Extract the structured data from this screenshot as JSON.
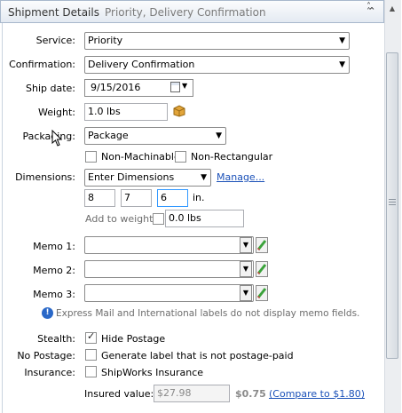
{
  "header": {
    "title": "Shipment Details",
    "subtitle": "Priority, Delivery Confirmation",
    "collapse_icon": "double-chevron-up"
  },
  "form": {
    "service": {
      "label": "Service:",
      "value": "Priority"
    },
    "confirmation": {
      "label": "Confirmation:",
      "value": "Delivery Confirmation"
    },
    "ship_date": {
      "label": "Ship date:",
      "value": "9/15/2016"
    },
    "weight": {
      "label": "Weight:",
      "value": "1.0 lbs"
    },
    "packaging": {
      "label": "Packaging:",
      "value": "Package"
    },
    "non_machinable": {
      "label": "Non-Machinable",
      "checked": false
    },
    "non_rectangular": {
      "label": "Non-Rectangular",
      "checked": false
    },
    "dimensions": {
      "label": "Dimensions:",
      "value": "Enter Dimensions",
      "manage_link": "Manage...",
      "length": "8",
      "width": "7",
      "height": "6",
      "unit": "in.",
      "add_to_weight_label": "Add to weight",
      "add_to_weight_checked": false,
      "add_weight_value": "0.0 lbs"
    },
    "memos": [
      {
        "label": "Memo 1:",
        "value": ""
      },
      {
        "label": "Memo 2:",
        "value": ""
      },
      {
        "label": "Memo 3:",
        "value": ""
      }
    ],
    "memo_note": "Express Mail and International labels do not display memo fields.",
    "stealth": {
      "label": "Stealth:",
      "option": "Hide Postage",
      "checked": true
    },
    "no_postage": {
      "label": "No Postage:",
      "option": "Generate label that is not postage-paid",
      "checked": false
    },
    "insurance": {
      "label": "Insurance:",
      "option": "ShipWorks Insurance",
      "checked": false
    },
    "insured_value": {
      "label": "Insured value:",
      "value": "$27.98",
      "cost": "$0.75",
      "compare_link": "(Compare to $1.80)"
    }
  },
  "colors": {
    "link": "#1a50b8",
    "header_border": "#a8b8cc",
    "focus_border": "#3399ff"
  }
}
